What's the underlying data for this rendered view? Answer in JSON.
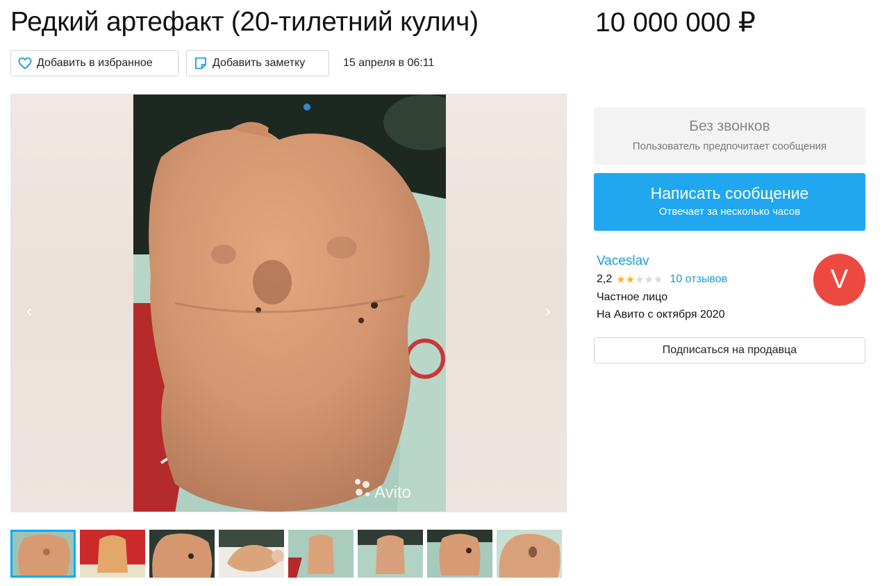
{
  "listing": {
    "title": "Редкий артефакт (20-тилетний кулич)",
    "price": "10 000 000 ₽",
    "date": "15 апреля в 06:11"
  },
  "actions": {
    "favorite_label": "Добавить в избранное",
    "note_label": "Добавить заметку"
  },
  "gallery": {
    "prev_arrow": "‹",
    "next_arrow": "›",
    "watermark": "Avito",
    "thumbnail_count": 8,
    "active_thumbnail": 1
  },
  "contact": {
    "no_calls_title": "Без звонков",
    "no_calls_subtitle": "Пользователь предпочитает сообщения",
    "message_button": "Написать сообщение",
    "message_subtitle": "Отвечает за несколько часов"
  },
  "seller": {
    "name": "Vaceslav",
    "rating": "2,2",
    "stars_filled": 2,
    "stars_total": 5,
    "reviews": "10 отзывов",
    "type": "Частное лицо",
    "since": "На Авито с октября 2020",
    "avatar_letter": "V",
    "subscribe_label": "Подписаться на продавца"
  },
  "colors": {
    "accent": "#20a7f0",
    "link": "#1c9ad6",
    "avatar": "#ec4940",
    "star": "#ffb021"
  },
  "icons": {
    "favorite": "heart-icon",
    "note": "sticky-note-icon",
    "prev": "chevron-left-icon",
    "next": "chevron-right-icon"
  }
}
